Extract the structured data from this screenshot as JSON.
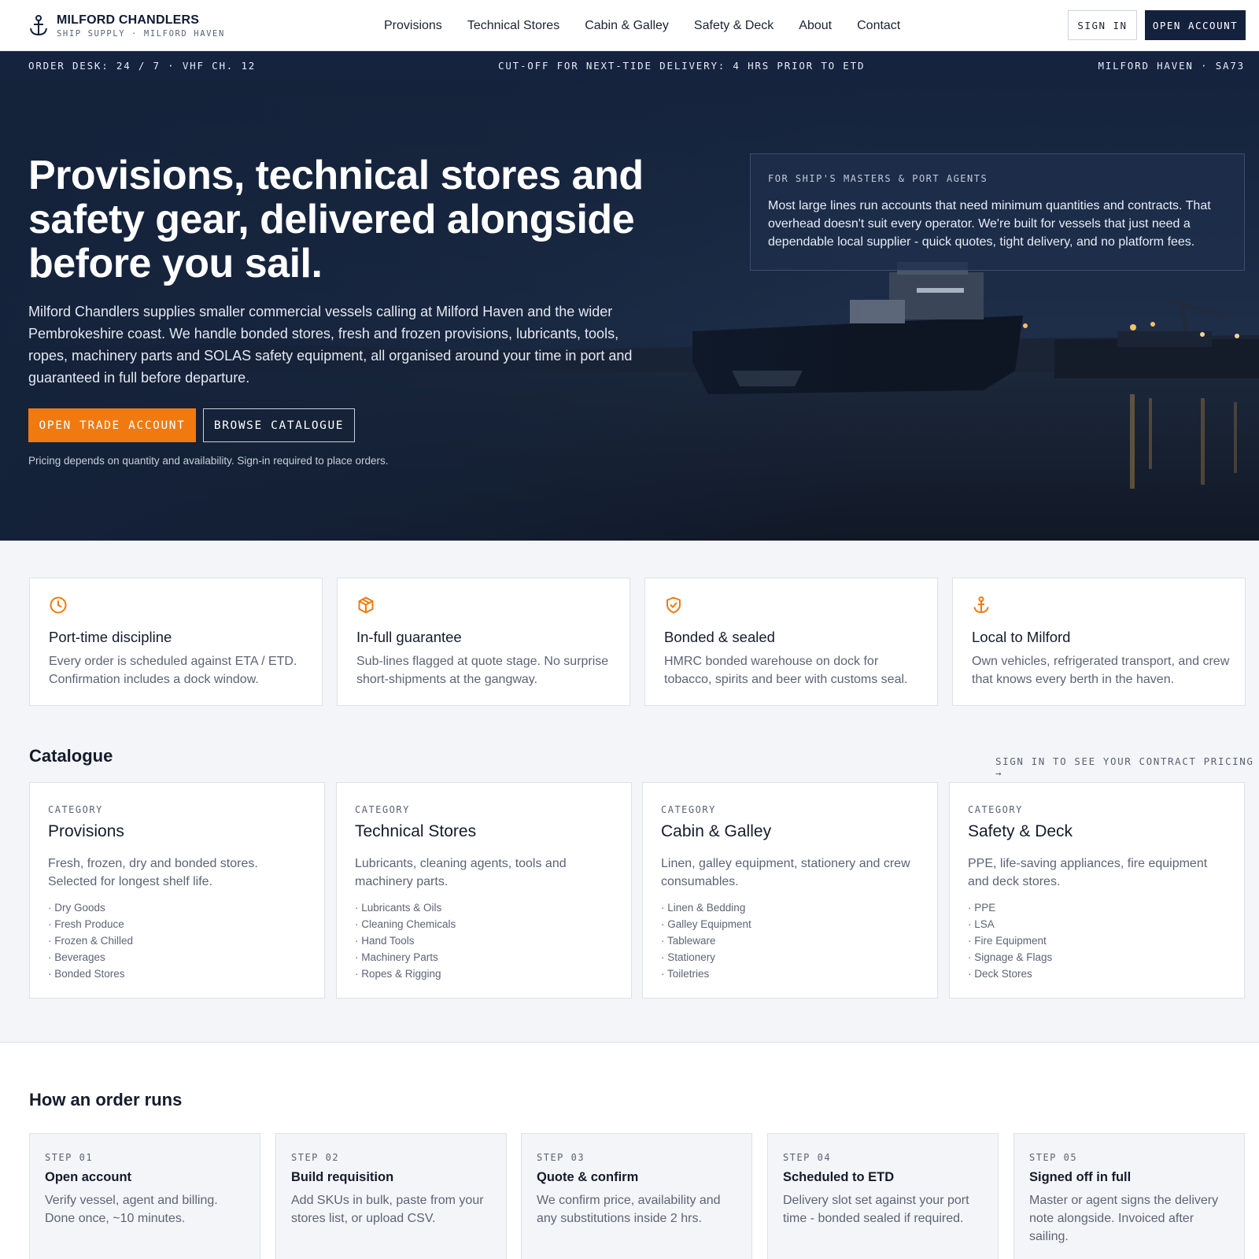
{
  "header": {
    "brand_name": "MILFORD CHANDLERS",
    "brand_sub": "SHIP SUPPLY · MILFORD HAVEN",
    "nav": [
      "Provisions",
      "Technical Stores",
      "Cabin & Galley",
      "Safety & Deck",
      "About",
      "Contact"
    ],
    "sign_in": "SIGN IN",
    "open_account": "OPEN ACCOUNT"
  },
  "ticker": {
    "left": "ORDER DESK: 24 / 7 · VHF CH. 12",
    "center": "CUT-OFF FOR NEXT-TIDE DELIVERY: 4 HRS PRIOR TO ETD",
    "right": "MILFORD HAVEN · SA73"
  },
  "hero": {
    "title": "Provisions, technical stores and safety gear, delivered alongside before you sail.",
    "text": "Milford Chandlers supplies smaller commercial vessels calling at Milford Haven and the wider Pembrokeshire coast. We handle bonded stores, fresh and frozen provisions, lubricants, tools, ropes, machinery parts and SOLAS safety equipment, all organised around your time in port and guaranteed in full before departure.",
    "primary_button": "OPEN TRADE ACCOUNT",
    "secondary_button": "BROWSE CATALOGUE",
    "note": "Pricing depends on quantity and availability. Sign-in required to place orders.",
    "card_label": "FOR SHIP'S MASTERS & PORT AGENTS",
    "card_text": "Most large lines run accounts that need minimum quantities and contracts. That overhead doesn't suit every operator. We're built for vessels that just need a dependable local supplier - quick quotes, tight delivery, and no platform fees."
  },
  "features": [
    {
      "icon": "clock-icon",
      "title": "Port-time discipline",
      "text": "Every order is scheduled against ETA / ETD. Confirmation includes a dock window."
    },
    {
      "icon": "box-icon",
      "title": "In-full guarantee",
      "text": "Sub-lines flagged at quote stage. No surprise short-shipments at the gangway."
    },
    {
      "icon": "shield-icon",
      "title": "Bonded & sealed",
      "text": "HMRC bonded warehouse on dock for tobacco, spirits and beer with customs seal."
    },
    {
      "icon": "anchor-icon",
      "title": "Local to Milford",
      "text": "Own vehicles, refrigerated transport, and crew that knows every berth in the haven."
    }
  ],
  "catalogue": {
    "title": "Catalogue",
    "link": "SIGN IN TO SEE YOUR CONTRACT PRICING →",
    "categories": [
      {
        "label": "CATEGORY",
        "title": "Provisions",
        "text": "Fresh, frozen, dry and bonded stores. Selected for longest shelf life.",
        "items": [
          "· Dry Goods",
          "· Fresh Produce",
          "· Frozen & Chilled",
          "· Beverages",
          "· Bonded Stores"
        ]
      },
      {
        "label": "CATEGORY",
        "title": "Technical Stores",
        "text": "Lubricants, cleaning agents, tools and machinery parts.",
        "items": [
          "· Lubricants & Oils",
          "· Cleaning Chemicals",
          "· Hand Tools",
          "· Machinery Parts",
          "· Ropes & Rigging"
        ]
      },
      {
        "label": "CATEGORY",
        "title": "Cabin & Galley",
        "text": "Linen, galley equipment, stationery and crew consumables.",
        "items": [
          "· Linen & Bedding",
          "· Galley Equipment",
          "· Tableware",
          "· Stationery",
          "· Toiletries"
        ]
      },
      {
        "label": "CATEGORY",
        "title": "Safety & Deck",
        "text": "PPE, life-saving appliances, fire equipment and deck stores.",
        "items": [
          "· PPE",
          "· LSA",
          "· Fire Equipment",
          "· Signage & Flags",
          "· Deck Stores"
        ]
      }
    ]
  },
  "how": {
    "title": "How an order runs",
    "steps": [
      {
        "label": "STEP 01",
        "title": "Open account",
        "text": "Verify vessel, agent and billing. Done once, ~10 minutes."
      },
      {
        "label": "STEP 02",
        "title": "Build requisition",
        "text": "Add SKUs in bulk, paste from your stores list, or upload CSV."
      },
      {
        "label": "STEP 03",
        "title": "Quote & confirm",
        "text": "We confirm price, availability and any substitutions inside 2 hrs."
      },
      {
        "label": "STEP 04",
        "title": "Scheduled to ETD",
        "text": "Delivery slot set against your port time - bonded sealed if required."
      },
      {
        "label": "STEP 05",
        "title": "Signed off in full",
        "text": "Master or agent signs the delivery note alongside. Invoiced after sailing."
      }
    ]
  },
  "colors": {
    "navy": "#14213d",
    "accent": "#f07a10",
    "background": "#f4f5f8"
  }
}
